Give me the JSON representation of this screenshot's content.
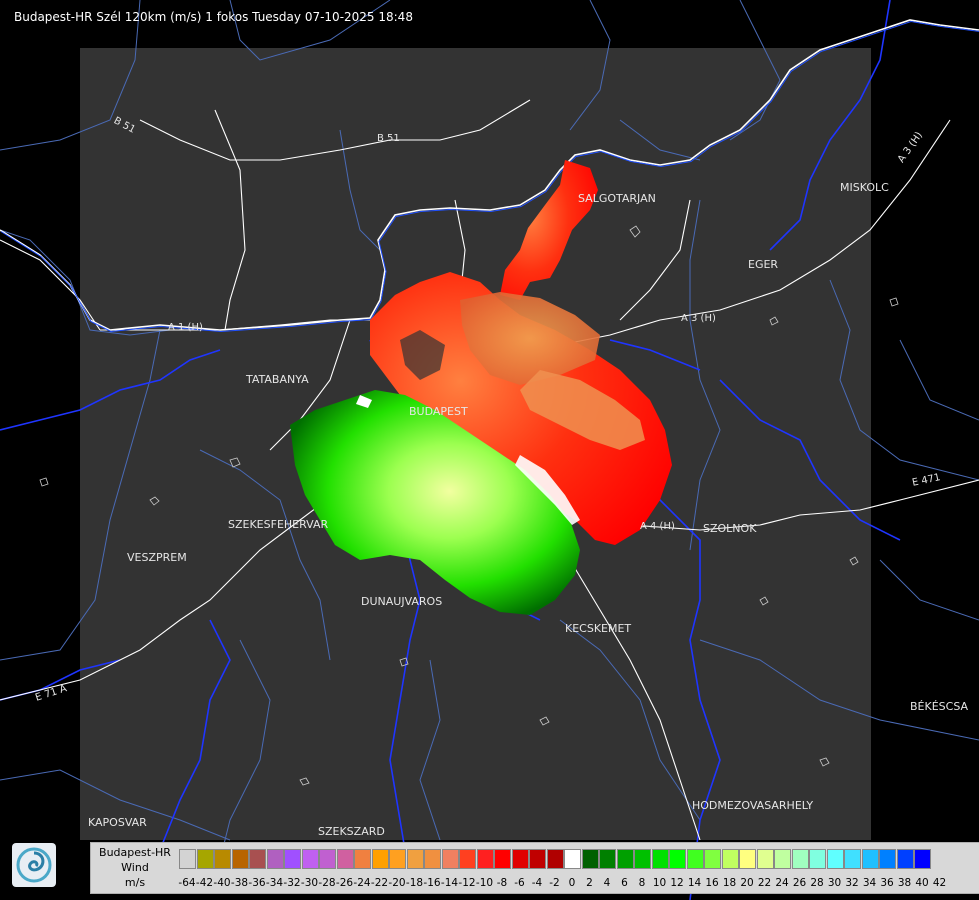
{
  "header": {
    "title": "Budapest-HR Szél 120km (m/s) 1 fokos Tuesday 07-10-2025 18:48"
  },
  "colors": {
    "background": "#000000",
    "coverage": "#333333",
    "border": "#ffffff",
    "rivers": "#1f35ff",
    "counties": "#4a6ab5",
    "roads": "#ffffff"
  },
  "cities": [
    {
      "id": "salgotarjan",
      "name": "SALGOTARJAN"
    },
    {
      "id": "eger",
      "name": "EGER"
    },
    {
      "id": "miskolc",
      "name": "MISKOLC"
    },
    {
      "id": "tatabanya",
      "name": "TATABANYA"
    },
    {
      "id": "budapest",
      "name": "BUDAPEST"
    },
    {
      "id": "szekesfehervar",
      "name": "SZEKESFEHERVAR"
    },
    {
      "id": "veszprem",
      "name": "VESZPREM"
    },
    {
      "id": "dunaujvaros",
      "name": "DUNAUJVAROS"
    },
    {
      "id": "kecskemet",
      "name": "KECSKEMET"
    },
    {
      "id": "szolnok",
      "name": "SZOLNOK"
    },
    {
      "id": "bekescsaba",
      "name": "BÉKÉSCSA"
    },
    {
      "id": "hodmezovasarhely",
      "name": "HODMEZOVASARHELY"
    },
    {
      "id": "kaposvar",
      "name": "KAPOSVAR"
    },
    {
      "id": "szekszard",
      "name": "SZEKSZARD"
    }
  ],
  "roads": [
    {
      "id": "b51a",
      "name": "B 51"
    },
    {
      "id": "b51b",
      "name": "B 51"
    },
    {
      "id": "a1",
      "name": "A 1 (H)"
    },
    {
      "id": "a3a",
      "name": "A 3 (H)"
    },
    {
      "id": "a3b",
      "name": "A 3 (H)"
    },
    {
      "id": "a4",
      "name": "A 4 (H)"
    },
    {
      "id": "e71",
      "name": "E 71 A"
    },
    {
      "id": "e471",
      "name": "E 471"
    }
  ],
  "legend": {
    "line1": "Budapest-HR",
    "line2": "Wind",
    "line3": "m/s",
    "ticks": [
      "-64",
      "-42",
      "-40",
      "-38",
      "-36",
      "-34",
      "-32",
      "-30",
      "-28",
      "-26",
      "-24",
      "-22",
      "-20",
      "-18",
      "-16",
      "-14",
      "-12",
      "-10",
      "-8",
      "-6",
      "-4",
      "-2",
      "0",
      "2",
      "4",
      "6",
      "8",
      "10",
      "12",
      "14",
      "16",
      "18",
      "20",
      "22",
      "24",
      "26",
      "28",
      "30",
      "32",
      "34",
      "36",
      "38",
      "40",
      "42"
    ],
    "colors": [
      "#d3d3d3",
      "#a6a600",
      "#b88a00",
      "#b86400",
      "#a85050",
      "#b060c0",
      "#a050ff",
      "#c060f0",
      "#c060d0",
      "#d060a0",
      "#f08040",
      "#ffa000",
      "#ffa020",
      "#f0a040",
      "#f09040",
      "#f08060",
      "#ff4020",
      "#ff2020",
      "#ff0000",
      "#e00000",
      "#c00000",
      "#b00000",
      "#ffffff",
      "#006000",
      "#008000",
      "#00a000",
      "#00c000",
      "#00e000",
      "#00ff00",
      "#40ff20",
      "#80ff40",
      "#c0ff60",
      "#ffff80",
      "#e0ff90",
      "#c0ffa0",
      "#a0ffc0",
      "#80ffe0",
      "#60ffff",
      "#40e0ff",
      "#20c0ff",
      "#0080ff",
      "#0040ff",
      "#0000ff"
    ]
  }
}
